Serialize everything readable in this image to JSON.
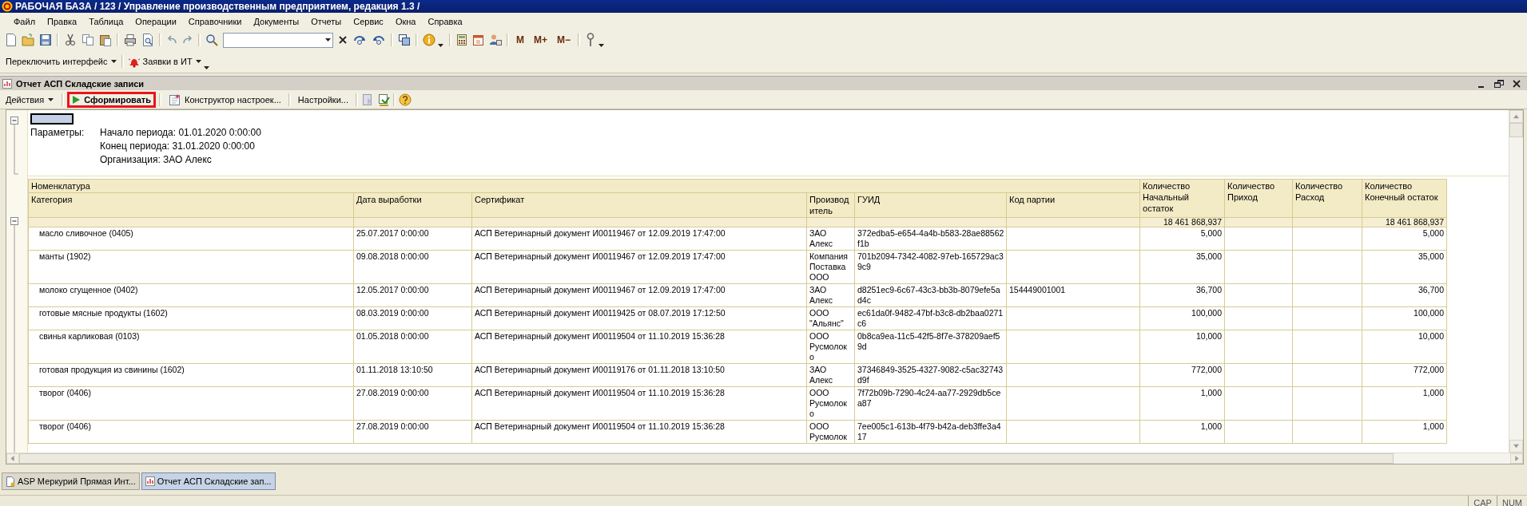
{
  "window": {
    "title": "РАБОЧАЯ БАЗА / 123 /  Управление производственным предприятием, редакция 1.3 /"
  },
  "menu": [
    "Файл",
    "Правка",
    "Таблица",
    "Операции",
    "Справочники",
    "Документы",
    "Отчеты",
    "Сервис",
    "Окна",
    "Справка"
  ],
  "memory_buttons": [
    "M",
    "M+",
    "M−"
  ],
  "toolbar_2": [
    {
      "label": "Переключить интерфейс",
      "kind": "dropdown"
    },
    {
      "label": "Заявки в ИТ",
      "kind": "alert-dropdown"
    }
  ],
  "document": {
    "title": "Отчет  АСП Складские записи"
  },
  "report_toolbar": [
    {
      "label": "Действия",
      "kind": "menu",
      "highlighted": false
    },
    {
      "label": "Сформировать",
      "kind": "run",
      "highlighted": true
    },
    {
      "label": "Конструктор настроек...",
      "kind": "designer",
      "highlighted": false
    },
    {
      "label": "Настройки...",
      "kind": "text",
      "highlighted": false
    }
  ],
  "parameters": {
    "label": "Параметры:",
    "lines": [
      "Начало периода: 01.01.2020 0:00:00",
      "Конец периода: 31.01.2020 0:00:00",
      "Организация: ЗАО Алекс"
    ]
  },
  "table": {
    "group_header": "Номенклатура",
    "columns": [
      {
        "label": "Категория",
        "kind": "category"
      },
      {
        "label": "Дата выработки",
        "kind": "text"
      },
      {
        "label": "Сертификат",
        "kind": "text"
      },
      {
        "label": "Производитель",
        "kind": "narrow"
      },
      {
        "label": "ГУИД",
        "kind": "code"
      },
      {
        "label": "Код партии",
        "kind": "text"
      },
      {
        "label": "Количество Начальный остаток",
        "kind": "quantity",
        "total": "18 461 868,937"
      },
      {
        "label": "Количество Приход",
        "kind": "quantity"
      },
      {
        "label": "Количество Расход",
        "kind": "quantity"
      },
      {
        "label": "Количество Конечный остаток",
        "kind": "quantity",
        "total": "18 461 868,937"
      }
    ],
    "rows": [
      [
        "масло сливочное (0405)",
        "25.07.2017 0:00:00",
        "АСП Ветеринарный документ И00119467 от 12.09.2019 17:47:00",
        "ЗАО Алекс",
        "372edba5-e654-4a4b-b583-28ae88562f1b",
        null,
        "5,000",
        null,
        null,
        "5,000"
      ],
      [
        "манты (1902)",
        "09.08.2018 0:00:00",
        "АСП Ветеринарный документ И00119467 от 12.09.2019 17:47:00",
        "Компания Поставка ООО",
        "701b2094-7342-4082-97eb-165729ac39c9",
        null,
        "35,000",
        null,
        null,
        "35,000"
      ],
      [
        "молоко сгущенное (0402)",
        "12.05.2017 0:00:00",
        "АСП Ветеринарный документ И00119467 от 12.09.2019 17:47:00",
        "ЗАО Алекс",
        "d8251ec9-6c67-43c3-bb3b-8079efe5ad4c",
        "154449001001",
        "36,700",
        null,
        null,
        "36,700"
      ],
      [
        "готовые мясные продукты (1602)",
        "08.03.2019 0:00:00",
        "АСП Ветеринарный документ И00119425 от 08.07.2019 17:12:50",
        "ООО \"Альянс\"",
        "ec61da0f-9482-47bf-b3c8-db2baa0271c6",
        null,
        "100,000",
        null,
        null,
        "100,000"
      ],
      [
        "свинья карликовая (0103)",
        "01.05.2018 0:00:00",
        "АСП Ветеринарный документ И00119504 от 11.10.2019 15:36:28",
        "ООО Русмолоко",
        "0b8ca9ea-11c5-42f5-8f7e-378209aef59d",
        null,
        "10,000",
        null,
        null,
        "10,000"
      ],
      [
        "готовая продукция из свинины (1602)",
        "01.11.2018 13:10:50",
        "АСП Ветеринарный документ И00119176 от 01.11.2018 13:10:50",
        "ЗАО Алекс",
        "37346849-3525-4327-9082-c5ac32743d9f",
        null,
        "772,000",
        null,
        null,
        "772,000"
      ],
      [
        "творог (0406)",
        "27.08.2019 0:00:00",
        "АСП Ветеринарный документ И00119504 от 11.10.2019 15:36:28",
        "ООО Русмолоко",
        "7f72b09b-7290-4c24-aa77-2929db5cea87",
        null,
        "1,000",
        null,
        null,
        "1,000"
      ],
      [
        "творог (0406)",
        "27.08.2019 0:00:00",
        "АСП Ветеринарный документ И00119504 от 11.10.2019 15:36:28",
        "ООО Русмолок",
        "7ee005c1-613b-4f79-b42a-deb3ffe3a417",
        null,
        "1,000",
        null,
        null,
        "1,000"
      ]
    ]
  },
  "taskbar": [
    {
      "label": "ASP Меркурий Прямая Инт...",
      "selected": false
    },
    {
      "label": "Отчет  АСП Складские зап...",
      "selected": true
    }
  ],
  "status_bar": [
    "CAP",
    "NUM"
  ]
}
